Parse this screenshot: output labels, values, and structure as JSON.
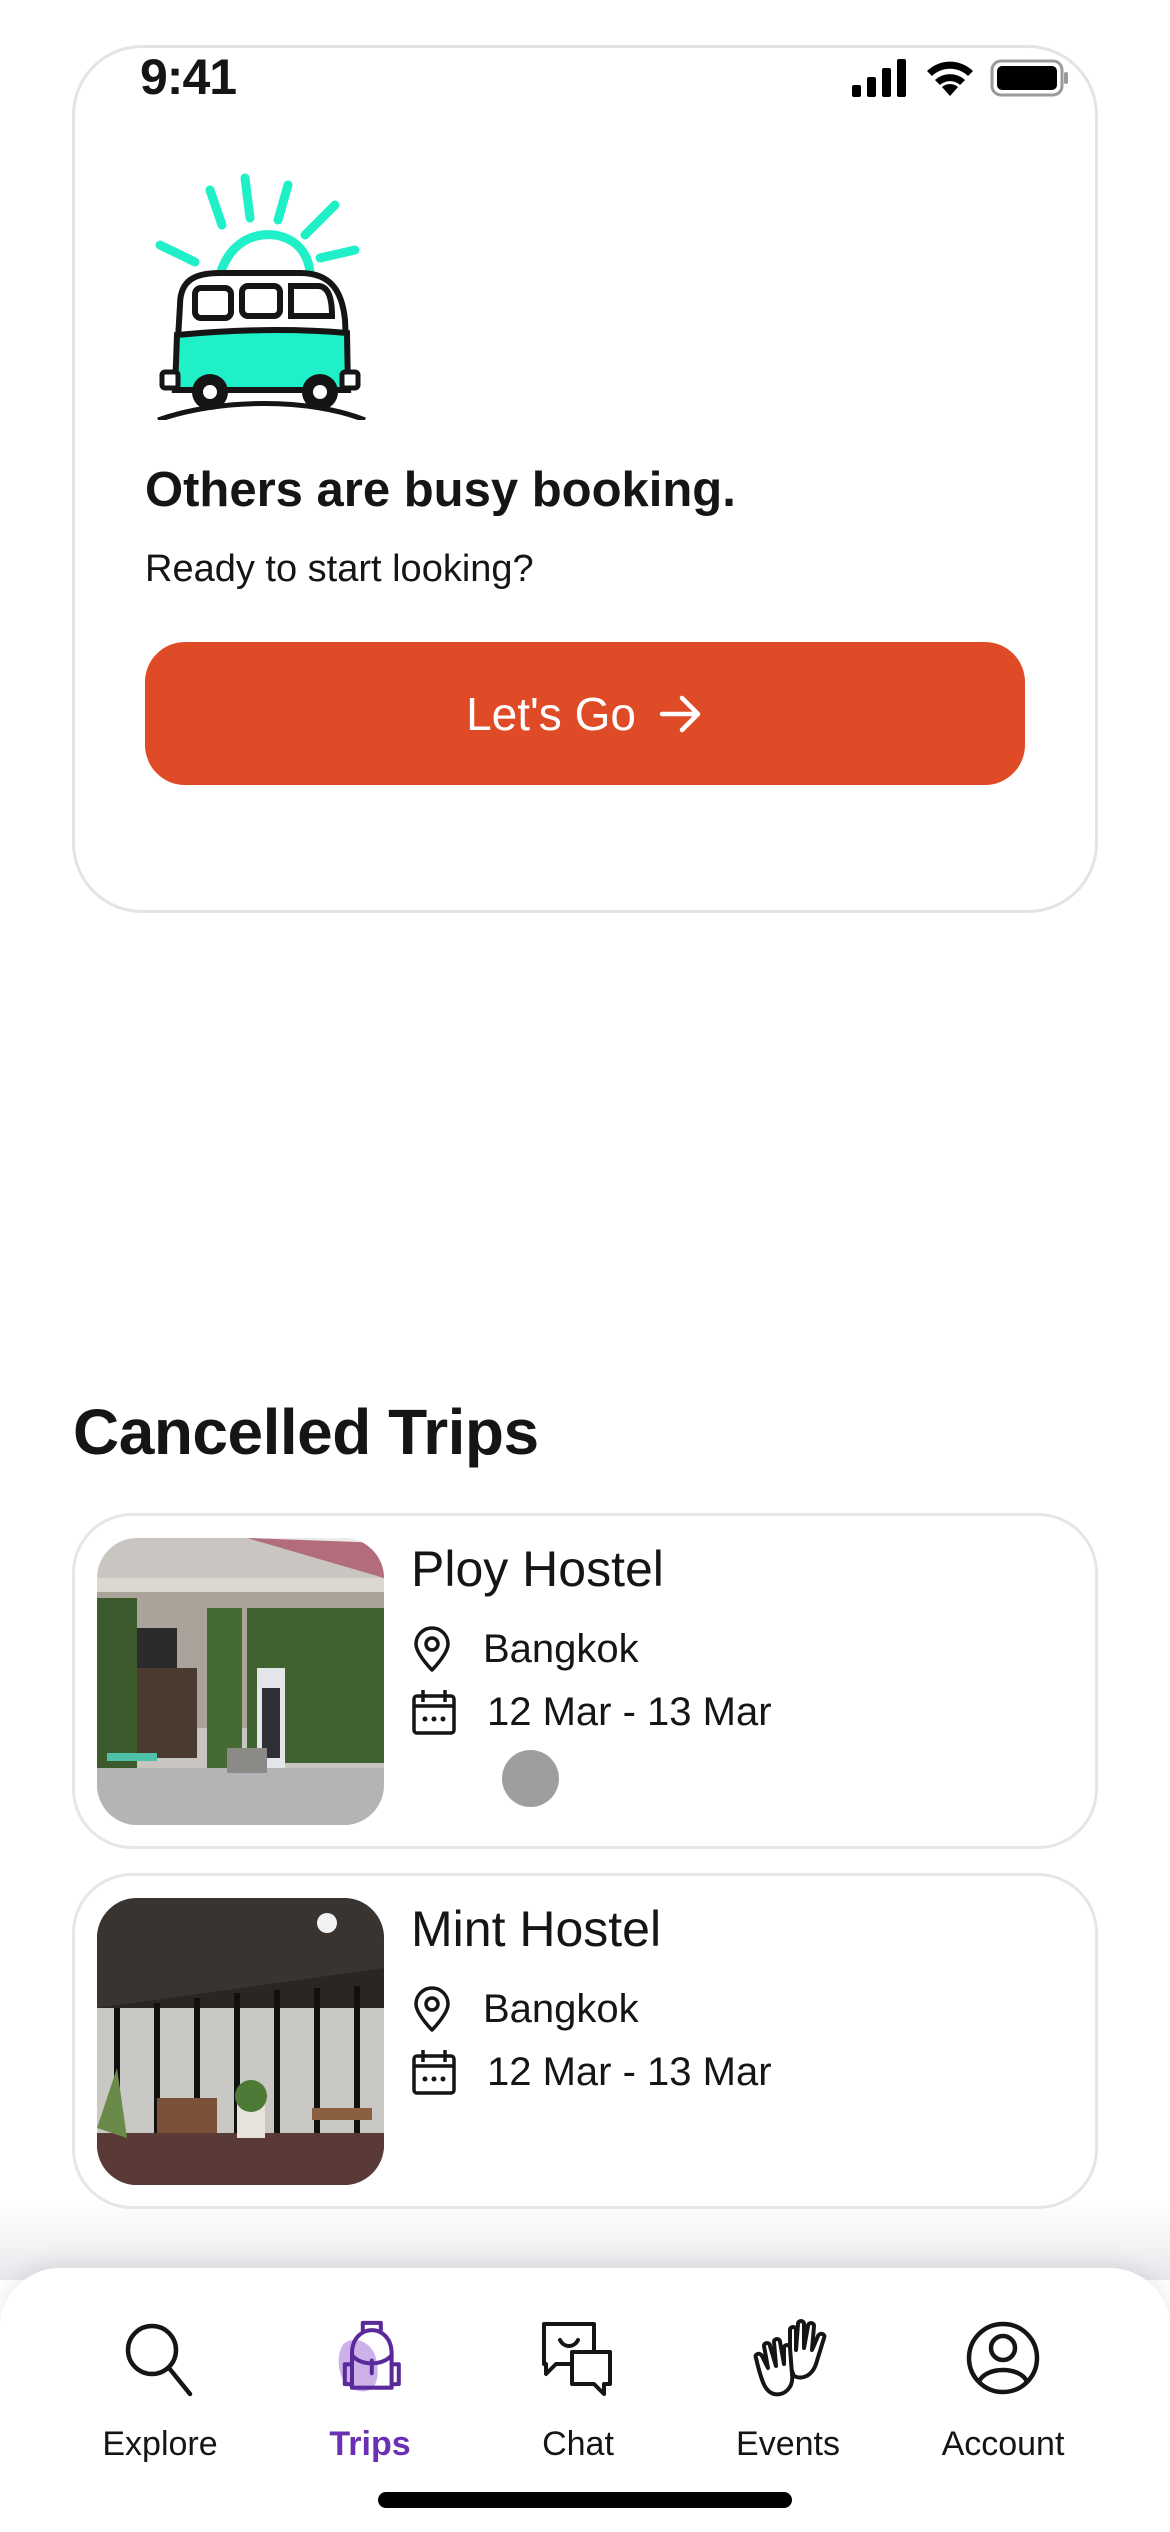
{
  "status_bar": {
    "time": "9:41"
  },
  "empty_state": {
    "illustration": "van-with-sun-illustration",
    "title": "Others are busy booking.",
    "subtitle": "Ready to start looking?",
    "cta_label": "Let's Go",
    "cta_icon": "arrow-right-icon"
  },
  "cancelled": {
    "title": "Cancelled Trips",
    "trips": [
      {
        "name": "Ploy Hostel",
        "location": "Bangkok",
        "dates": "12 Mar - 13 Mar",
        "photo": "hostel-exterior-photo"
      },
      {
        "name": "Mint Hostel",
        "location": "Bangkok",
        "dates": "12 Mar - 13 Mar",
        "photo": "hostel-patio-photo"
      }
    ]
  },
  "tabbar": {
    "active": "Trips",
    "items": [
      {
        "label": "Explore",
        "icon": "search-icon"
      },
      {
        "label": "Trips",
        "icon": "backpack-icon"
      },
      {
        "label": "Chat",
        "icon": "chat-bubbles-icon"
      },
      {
        "label": "Events",
        "icon": "high-five-icon"
      },
      {
        "label": "Account",
        "icon": "user-circle-icon"
      }
    ]
  },
  "colors": {
    "primary_cta": "#e04b27",
    "accent": "#6a2fb2",
    "accent_soft": "#cdb2ea",
    "illustration_teal": "#1ff0c8"
  }
}
